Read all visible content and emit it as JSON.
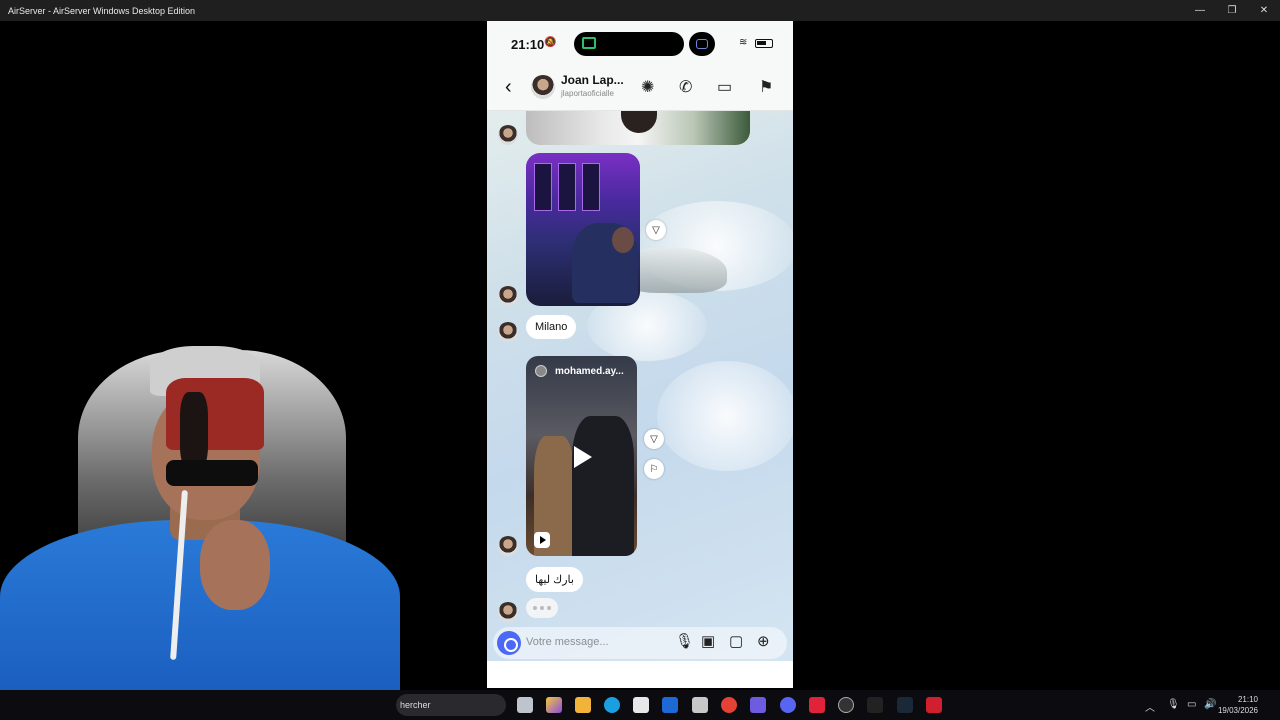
{
  "window": {
    "title": "AirServer - AirServer Windows Desktop Edition",
    "minimize": "—",
    "maximize": "❐",
    "close": "✕"
  },
  "phone_status": {
    "time": "21:10",
    "silent_icon": "bell-slash-icon"
  },
  "chat_header": {
    "name": "Joan Lap...",
    "handle": "jlaportaoficialle",
    "back_icon": "‹",
    "icons": [
      "sparkle-icon",
      "phone-icon",
      "video-icon",
      "flag-icon"
    ]
  },
  "messages": {
    "milano": "Milano",
    "reel_user": "mohamed.ay...",
    "arabic": "بارك ليها"
  },
  "composer": {
    "placeholder": "Votre message..."
  },
  "taskbar": {
    "search_text": "hercher",
    "clock_time": "21:10",
    "clock_date": "19/03/2026"
  },
  "colors": {
    "accent": "#4c69f5",
    "taskbar": "#0b0b10"
  }
}
